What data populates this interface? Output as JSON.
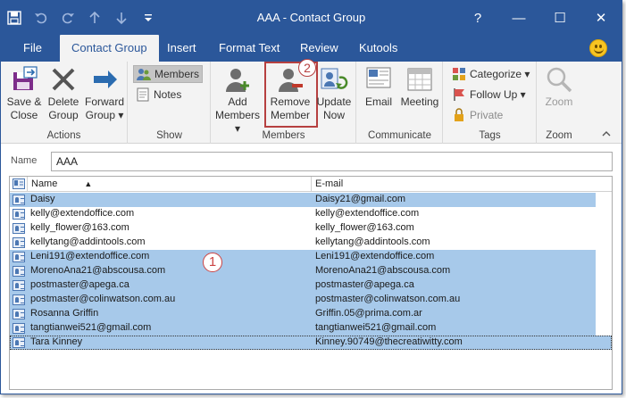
{
  "window": {
    "title": "AAA - Contact Group"
  },
  "qat": [
    "save-icon",
    "undo-icon",
    "redo-icon",
    "up-icon",
    "down-icon",
    "customize-icon"
  ],
  "winctl": {
    "help": "?",
    "min": "—",
    "max": "☐",
    "close": "✕"
  },
  "tabs": [
    {
      "label": "File",
      "active": false
    },
    {
      "label": "Contact Group",
      "active": true
    },
    {
      "label": "Insert",
      "active": false
    },
    {
      "label": "Format Text",
      "active": false
    },
    {
      "label": "Review",
      "active": false
    },
    {
      "label": "Kutools",
      "active": false
    }
  ],
  "ribbon": {
    "actions": {
      "label": "Actions",
      "save_close": [
        "Save &",
        "Close"
      ],
      "delete_group": [
        "Delete",
        "Group"
      ],
      "forward_group": [
        "Forward",
        "Group ▾"
      ]
    },
    "show": {
      "label": "Show",
      "members": "Members",
      "notes": "Notes"
    },
    "members": {
      "label": "Members",
      "add": [
        "Add",
        "Members ▾"
      ],
      "remove": [
        "Remove",
        "Member"
      ],
      "update": [
        "Update",
        "Now"
      ]
    },
    "communicate": {
      "label": "Communicate",
      "email": "Email",
      "meeting": "Meeting"
    },
    "tags": {
      "label": "Tags",
      "categorize": "Categorize ▾",
      "follow_up": "Follow Up ▾",
      "private": "Private"
    },
    "zoom": {
      "label": "Zoom",
      "zoom": "Zoom"
    },
    "callout": "2"
  },
  "form": {
    "name_label": "Name",
    "name_value": "AAA"
  },
  "grid": {
    "headers": {
      "name": "Name",
      "email": "E-mail"
    },
    "callout": "1",
    "rows": [
      {
        "name": "Daisy",
        "email": "Daisy21@gmail.com",
        "selected": true
      },
      {
        "name": "kelly@extendoffice.com",
        "email": "kelly@extendoffice.com",
        "selected": false
      },
      {
        "name": "kelly_flower@163.com",
        "email": "kelly_flower@163.com",
        "selected": false
      },
      {
        "name": "kellytang@addintools.com",
        "email": "kellytang@addintools.com",
        "selected": false
      },
      {
        "name": "Leni191@extendoffice.com",
        "email": "Leni191@extendoffice.com",
        "selected": true
      },
      {
        "name": "MorenoAna21@abscousa.com",
        "email": "MorenoAna21@abscousa.com",
        "selected": true
      },
      {
        "name": "postmaster@apega.ca",
        "email": "postmaster@apega.ca",
        "selected": true
      },
      {
        "name": "postmaster@colinwatson.com.au",
        "email": "postmaster@colinwatson.com.au",
        "selected": true
      },
      {
        "name": "Rosanna Griffin",
        "email": "Griffin.05@prima.com.ar",
        "selected": true
      },
      {
        "name": "tangtianwei521@gmail.com",
        "email": "tangtianwei521@gmail.com",
        "selected": true
      },
      {
        "name": "Tara Kinney",
        "email": "Kinney.90749@thecreatiwitty.com",
        "selected": true
      }
    ]
  }
}
